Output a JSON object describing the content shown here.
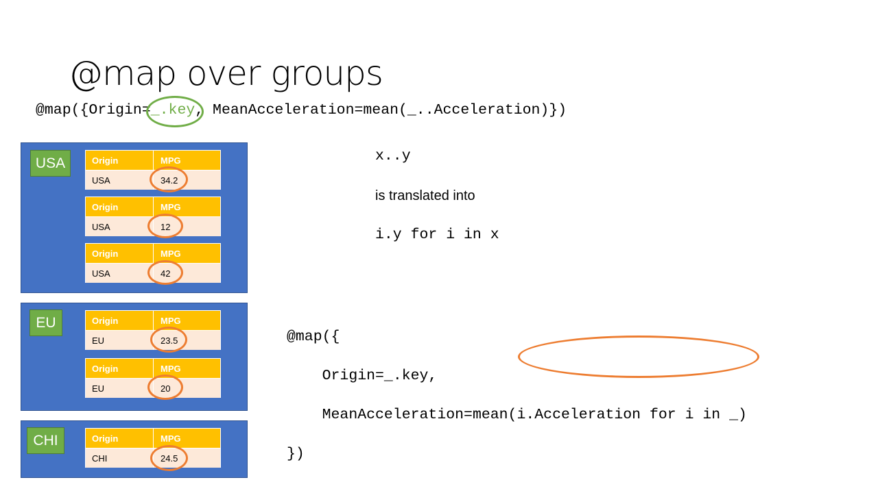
{
  "title": "@map over groups",
  "headline": {
    "prefix": "@map({Origin=",
    "key": "_.key",
    "suffix": ", MeanAcceleration=mean(_..Acceleration)})"
  },
  "explanation": {
    "pattern": "x..y",
    "middle": "is translated into",
    "result": "i.y for i in x"
  },
  "code": {
    "line1": "@map({",
    "line2": "    Origin=_.key,",
    "line3": "    MeanAcceleration=mean(i.Acceleration for i in _)",
    "line4": "})"
  },
  "table_headers": {
    "origin": "Origin",
    "mpg": "MPG"
  },
  "groups": [
    {
      "label": "USA",
      "rows": [
        {
          "origin": "USA",
          "mpg": "34.2"
        },
        {
          "origin": "USA",
          "mpg": "12"
        },
        {
          "origin": "USA",
          "mpg": "42"
        }
      ]
    },
    {
      "label": "EU",
      "rows": [
        {
          "origin": "EU",
          "mpg": "23.5"
        },
        {
          "origin": "EU",
          "mpg": "20"
        }
      ]
    },
    {
      "label": "CHI",
      "rows": [
        {
          "origin": "CHI",
          "mpg": "24.5"
        }
      ]
    }
  ],
  "colors": {
    "group_bg": "#4472c4",
    "label_bg": "#70ad47",
    "table_header": "#ffc000",
    "table_row": "#fde9d9",
    "highlight_green": "#70ad47",
    "highlight_orange": "#ed7d31"
  }
}
